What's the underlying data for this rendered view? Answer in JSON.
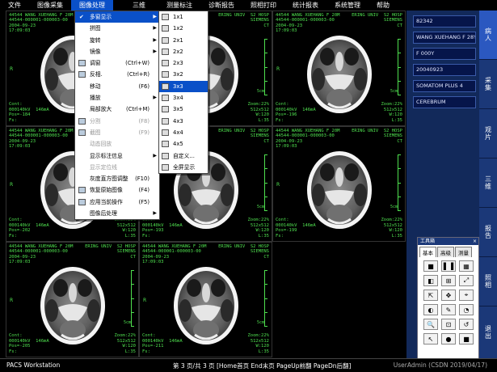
{
  "menubar": {
    "items": [
      {
        "label": "文件"
      },
      {
        "label": "图像采集"
      },
      {
        "label": "图像处理"
      },
      {
        "label": "三维"
      },
      {
        "label": "测量标注"
      },
      {
        "label": "诊断报告"
      },
      {
        "label": "照相打印"
      },
      {
        "label": "统计报表"
      },
      {
        "label": "系统管理"
      },
      {
        "label": "帮助"
      }
    ]
  },
  "viewer": {
    "cells": [
      {
        "tl": "44544 WANG XUEHANG F 20M\n44544-000001-000003-00\n2004-09-23\n17:09:03",
        "tr": "KING UNIV  S2 HOSP\n        SIEMENS\n         CT",
        "bl": "Cont:\n000140kV  146mA\nPos=-184\nFs:",
        "br": "Zoom:22%\n512x512\nW:120\n  L:35",
        "scale": "5cm",
        "dir": "R"
      },
      {
        "tl": "44544 WANG XUEHANG F 20M\n44544-000001-000003-00\n2004-09-23\n17:09:03",
        "tr": "ERING UNIV  S2 HOSP\n        SIEMENS\n         CT",
        "bl": "Cont:\n000140kV  146mA\nPos=-190\nFs:",
        "br": "Zoom:22%\n512x512\nW:120\n  L:35",
        "scale": "5cm",
        "dir": "R"
      },
      {
        "tl": "44544 WANG XUEHANG F 20M\n44544-000001-000003-00\n2004-09-23\n17:09:03",
        "tr": "ERING UNIV  S2 HOSP\n        SIEMENS\n         CT",
        "bl": "Cont:\n000140kV  146mA\nPos=-196\nFs:",
        "br": "Zoom:22%\n512x512\nW:120\n  L:35",
        "scale": "5cm",
        "dir": "R"
      },
      {
        "tl": "44544 WANG XUEHANG F 20M\n44544-000001-000003-00\n2004-09-23\n17:09:03",
        "tr": "ERING UNIV  S2 HOSP\n        SIEMENS\n         CT",
        "bl": "Cont:\n000140kV  146mA\nPos=-202\nFs:",
        "br": "Zoom:22%\n512x512\nW:120\n  L:35",
        "scale": "5cm",
        "dir": "R"
      },
      {
        "tl": "44544 WANG XUEHANG F 20M\n44544-000001-000003-00\n2004-09-23\n17:09:03",
        "tr": "ERING UNIV  S2 HOSP\n        SIEMENS\n         CT",
        "bl": "Cont:\n000140kV  146mA\nPos=-193\nFs:",
        "br": "Zoom:22%\n512x512\nW:120\n  L:35",
        "scale": "5cm",
        "dir": "R"
      },
      {
        "tl": "44544 WANG XUEHANG F 20M\n44544-000001-000003-00\n2004-09-23\n17:09:03",
        "tr": "ERING UNIV  S2 HOSP\n        SIEMENS\n         CT",
        "bl": "Cont:\n000140kV  146mA\nPos=-199\nFs:",
        "br": "Zoom:22%\n512x512\nW:120\n  L:35",
        "scale": "5cm",
        "dir": "R"
      },
      {
        "tl": "44544 WANG XUEHANG F 20M\n44544-000001-000003-00\n2004-09-23\n17:09:03",
        "tr": "ERING UNIV  S2 HOSP\n        SIEMENS\n         CT",
        "bl": "Cont:\n000140kV  146mA\nPos=-205\nFs:",
        "br": "Zoom:22%\n512x512\nW:120\n  L:35",
        "scale": "5cm",
        "dir": "R"
      },
      {
        "tl": "44544 WANG XUEHANG F 20M\n44544-000001-000003-00\n2004-09-23\n17:09:03",
        "tr": "ERING UNIV  S2 HOSP\n        SIEMENS\n         CT",
        "bl": "Cont:\n000140kV  146mA\nPos=-211\nFs:",
        "br": "Zoom:22%\n512x512\nW:120\n  L:35",
        "scale": "5cm",
        "dir": "R"
      }
    ]
  },
  "status": {
    "app": "PACS Workstation",
    "page": "第 3 页/共 3 页 [Home首页 End末页 PageUp前翻 PageDn后翻]",
    "user": "UserAdmin  (CSDN 2019/04/17)"
  },
  "patient": {
    "id": "82342",
    "name_line": "WANG XUEHANG F 28Y",
    "sex_line": "F 000Y",
    "date": "20040923",
    "device": "SOMATOM PLUS 4",
    "body_part": "CEREBRUM"
  },
  "side_tabs": [
    {
      "label": "病人"
    },
    {
      "label": "采集"
    },
    {
      "label": "观片"
    },
    {
      "label": "三维"
    },
    {
      "label": "报告"
    },
    {
      "label": "照相"
    },
    {
      "label": "退出"
    }
  ],
  "toolbox": {
    "title": "工具箱",
    "close": "×",
    "tabs": [
      "基本",
      "高级",
      "测量"
    ],
    "buttons": [
      {
        "glyph": "■",
        "name": "layout-1x1-icon"
      },
      {
        "glyph": "▌▐",
        "name": "layout-1x2-icon"
      },
      {
        "glyph": "▦",
        "name": "layout-grid-icon"
      },
      {
        "glyph": "◧",
        "name": "series-icon"
      },
      {
        "glyph": "⊞",
        "name": "tile-icon"
      },
      {
        "glyph": "⤢",
        "name": "fit-icon"
      },
      {
        "glyph": "⇱",
        "name": "expand-icon"
      },
      {
        "glyph": "✥",
        "name": "pan-icon"
      },
      {
        "glyph": "⌖",
        "name": "crosshair-icon"
      },
      {
        "glyph": "◐",
        "name": "window-level-icon"
      },
      {
        "glyph": "✎",
        "name": "annotate-icon"
      },
      {
        "glyph": "◔",
        "name": "invert-icon"
      },
      {
        "glyph": "🔍",
        "name": "magnify-icon"
      },
      {
        "glyph": "⊡",
        "name": "zoom-icon"
      },
      {
        "glyph": "↺",
        "name": "reset-icon"
      },
      {
        "glyph": "↖",
        "name": "pointer-icon"
      },
      {
        "glyph": "●",
        "name": "record-icon"
      },
      {
        "glyph": "■",
        "name": "stop-icon"
      }
    ]
  },
  "image_menu": {
    "items": [
      {
        "label": "多窗显示",
        "check": "✔",
        "arrow": "▶",
        "hl": true
      },
      {
        "label": "拼图",
        "arrow": "▶"
      },
      {
        "label": "旋转",
        "arrow": "▶"
      },
      {
        "label": "镜像",
        "arrow": "▶"
      },
      {
        "label": "调窗",
        "shortcut": "(Ctrl+W)",
        "icon": true
      },
      {
        "label": "反相.",
        "shortcut": "(Ctrl+R)",
        "icon": true
      },
      {
        "label": "移动",
        "shortcut": "(F6)"
      },
      {
        "label": "播放",
        "arrow": "▶"
      },
      {
        "label": "局部放大",
        "shortcut": "(Ctrl+M)"
      },
      {
        "label": "分割",
        "shortcut": "(F8)",
        "dis": true,
        "icon": true
      },
      {
        "label": "截图",
        "shortcut": "(F9)",
        "dis": true,
        "icon": true
      },
      {
        "label": "动态回放",
        "dis": true
      },
      {
        "label": "显示标注信息",
        "arrow": "▶"
      },
      {
        "label": "显示定位线",
        "dis": true
      },
      {
        "label": "灰度直方图调整",
        "shortcut": "(F10)"
      },
      {
        "label": "恢复原始图像",
        "shortcut": "(F4)",
        "icon": true
      },
      {
        "label": "应用当前操作",
        "shortcut": "(F5)",
        "icon": true
      },
      {
        "label": "图像后处理",
        "arrow": "▶"
      }
    ]
  },
  "layout_menu": {
    "items": [
      {
        "label": "1x1"
      },
      {
        "label": "1x2"
      },
      {
        "label": "2x1"
      },
      {
        "label": "2x2"
      },
      {
        "label": "2x3"
      },
      {
        "label": "3x2"
      },
      {
        "label": "3x3",
        "hl": true
      },
      {
        "label": "3x4"
      },
      {
        "label": "3x5"
      },
      {
        "label": "4x3"
      },
      {
        "label": "4x4"
      },
      {
        "label": "4x5"
      },
      {
        "label": "自定义..."
      },
      {
        "label": "全屏显示"
      }
    ]
  }
}
